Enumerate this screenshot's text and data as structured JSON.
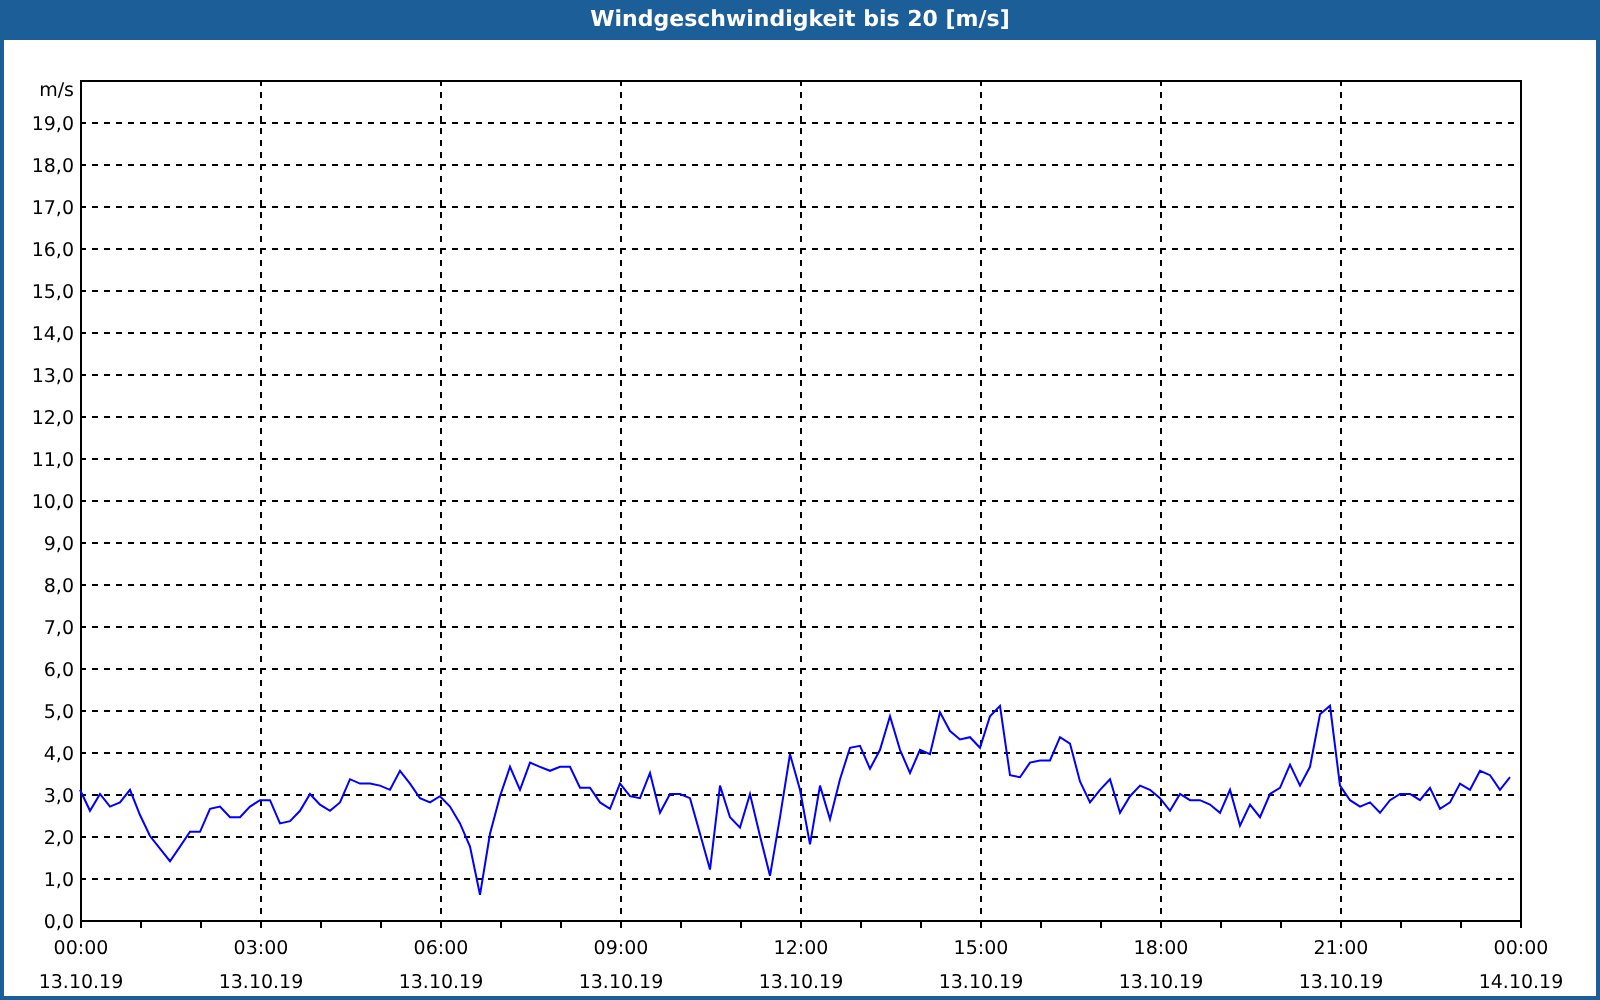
{
  "window": {
    "title": "Windgeschwindigkeit bis 20 [m/s]"
  },
  "chart": {
    "chart_data": {
      "type": "line",
      "ylabel": "m/s",
      "categories": [
        "00:00\n13.10.19",
        null,
        null,
        null,
        null,
        null,
        null,
        null,
        null,
        null,
        null,
        null,
        null,
        null,
        null,
        null,
        null,
        null,
        "03:00\n13.10.19",
        null,
        null,
        null,
        null,
        null,
        null,
        null,
        null,
        null,
        null,
        null,
        null,
        null,
        null,
        null,
        null,
        null,
        "06:00\n13.10.19",
        null,
        null,
        null,
        null,
        null,
        null,
        null,
        null,
        null,
        null,
        null,
        null,
        null,
        null,
        null,
        null,
        null,
        "09:00\n13.10.19",
        null,
        null,
        null,
        null,
        null,
        null,
        null,
        null,
        null,
        null,
        null,
        null,
        null,
        null,
        null,
        null,
        null,
        "12:00\n13.10.19",
        null,
        null,
        null,
        null,
        null,
        null,
        null,
        null,
        null,
        null,
        null,
        null,
        null,
        null,
        null,
        null,
        null,
        "15:00\n13.10.19",
        null,
        null,
        null,
        null,
        null,
        null,
        null,
        null,
        null,
        null,
        null,
        null,
        null,
        null,
        null,
        null,
        null,
        "18:00\n13.10.19",
        null,
        null,
        null,
        null,
        null,
        null,
        null,
        null,
        null,
        null,
        null,
        null,
        null,
        null,
        null,
        null,
        null,
        "21:00\n13.10.19",
        null,
        null,
        null,
        null,
        null,
        null,
        null,
        null,
        null,
        null,
        null,
        null,
        null,
        null,
        null,
        null,
        null,
        "00:00\n14.10.19"
      ],
      "series": [
        {
          "color": "#0000ff",
          "values": [
            3.1,
            2.6,
            3.0,
            2.7,
            2.8,
            3.1,
            2.5,
            2.0,
            1.7,
            1.4,
            1.75,
            2.1,
            2.1,
            2.65,
            2.7,
            2.45,
            2.45,
            2.7,
            2.85,
            2.85,
            2.3,
            2.35,
            2.6,
            3.0,
            2.75,
            2.6,
            2.8,
            3.35,
            3.25,
            3.25,
            3.2,
            3.1,
            3.55,
            3.25,
            2.9,
            2.8,
            2.95,
            2.7,
            2.3,
            1.75,
            0.6,
            2.05,
            2.95,
            3.65,
            3.1,
            3.75,
            3.65,
            3.55,
            3.65,
            3.65,
            3.15,
            3.15,
            2.8,
            2.65,
            3.25,
            2.95,
            2.9,
            3.5,
            2.55,
            3.0,
            3.0,
            2.9,
            2.05,
            1.2,
            3.2,
            2.45,
            2.2,
            3.0,
            2.0,
            1.05,
            2.45,
            3.95,
            3.1,
            1.8,
            3.2,
            2.4,
            3.35,
            4.1,
            4.15,
            3.6,
            4.05,
            4.85,
            4.05,
            3.5,
            4.05,
            3.95,
            4.95,
            4.5,
            4.3,
            4.35,
            4.1,
            4.85,
            5.1,
            3.45,
            3.4,
            3.75,
            3.8,
            3.8,
            4.35,
            4.2,
            3.3,
            2.8,
            3.1,
            3.35,
            2.55,
            2.95,
            3.2,
            3.1,
            2.9,
            2.6,
            3.0,
            2.85,
            2.85,
            2.75,
            2.55,
            3.1,
            2.25,
            2.75,
            2.45,
            3.0,
            3.15,
            3.7,
            3.2,
            3.65,
            4.9,
            5.1,
            3.2,
            2.85,
            2.7,
            2.8,
            2.55,
            2.85,
            3.0,
            3.0,
            2.85,
            3.15,
            2.65,
            2.8,
            3.25,
            3.1,
            3.55,
            3.45,
            3.1,
            3.4,
            null
          ]
        }
      ],
      "ylim": [
        0,
        20
      ],
      "grid": true,
      "yticks": [
        {
          "value": 0,
          "label": "0,0"
        },
        {
          "value": 1,
          "label": "1,0"
        },
        {
          "value": 2,
          "label": "2,0"
        },
        {
          "value": 3,
          "label": "3,0"
        },
        {
          "value": 4,
          "label": "4,0"
        },
        {
          "value": 5,
          "label": "5,0"
        },
        {
          "value": 6,
          "label": "6,0"
        },
        {
          "value": 7,
          "label": "7,0"
        },
        {
          "value": 8,
          "label": "8,0"
        },
        {
          "value": 9,
          "label": "9,0"
        },
        {
          "value": 10,
          "label": "10,0"
        },
        {
          "value": 11,
          "label": "11,0"
        },
        {
          "value": 12,
          "label": "12,0"
        },
        {
          "value": 13,
          "label": "13,0"
        },
        {
          "value": 14,
          "label": "14,0"
        },
        {
          "value": 15,
          "label": "15,0"
        },
        {
          "value": 16,
          "label": "16,0"
        },
        {
          "value": 17,
          "label": "17,0"
        },
        {
          "value": 18,
          "label": "18,0"
        },
        {
          "value": 19,
          "label": "19,0"
        }
      ]
    }
  }
}
